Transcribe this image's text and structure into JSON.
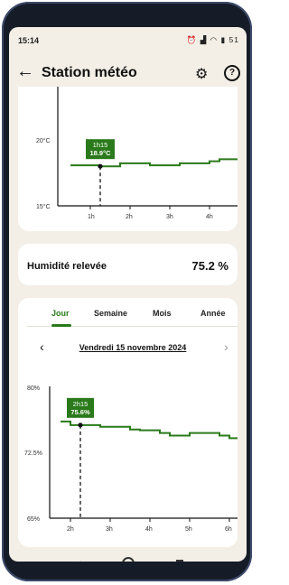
{
  "status": {
    "time": "15:14",
    "battery": "51"
  },
  "appbar": {
    "title": "Station météo"
  },
  "temp_chart": {
    "tooltip_time": "1h15",
    "tooltip_value": "18.9°C",
    "y_ticks": [
      "20°C",
      "15°C"
    ],
    "x_ticks": [
      "1h",
      "2h",
      "3h",
      "4h"
    ]
  },
  "humidity": {
    "label": "Humidité relevée",
    "value": "75.2 %"
  },
  "tabs": [
    "Jour",
    "Semaine",
    "Mois",
    "Année"
  ],
  "date_label": "Vendredi 15 novembre 2024",
  "humidity_chart": {
    "tooltip_time": "2h15",
    "tooltip_value": "75.6%",
    "y_ticks": [
      "80%",
      "72.5%",
      "65%"
    ],
    "x_ticks": [
      "2h",
      "3h",
      "4h",
      "5h",
      "6h"
    ]
  },
  "chart_data": [
    {
      "type": "line",
      "title": "",
      "ylabel": "",
      "xlabel": "",
      "ylim": [
        15,
        21.5
      ],
      "x": [
        "0h30",
        "0h45",
        "1h00",
        "1h15",
        "1h30",
        "1h45",
        "2h00",
        "2h15",
        "2h30",
        "2h45",
        "3h00",
        "3h15",
        "3h30",
        "3h45",
        "4h00",
        "4h15",
        "4h30",
        "4h45"
      ],
      "values": [
        19.0,
        19.0,
        19.0,
        18.9,
        18.9,
        19.2,
        19.2,
        19.2,
        19.0,
        19.0,
        19.0,
        19.2,
        19.2,
        19.2,
        19.4,
        19.6,
        19.6,
        19.4
      ],
      "highlight": {
        "x": "1h15",
        "y": 18.9
      }
    },
    {
      "type": "line",
      "title": "",
      "ylabel": "",
      "xlabel": "",
      "ylim": [
        65,
        80
      ],
      "x": [
        "1h45",
        "2h00",
        "2h15",
        "2h30",
        "2h45",
        "3h00",
        "3h15",
        "3h30",
        "3h45",
        "4h00",
        "4h15",
        "4h30",
        "4h45",
        "5h00",
        "5h15",
        "5h30",
        "5h45",
        "6h00",
        "6h15"
      ],
      "values": [
        76.0,
        75.6,
        75.6,
        75.6,
        75.4,
        75.4,
        75.4,
        75.1,
        75.0,
        75.0,
        74.7,
        74.4,
        74.4,
        74.7,
        74.7,
        74.7,
        74.4,
        74.1,
        74.1
      ],
      "highlight": {
        "x": "2h15",
        "y": 75.6
      }
    }
  ],
  "colors": {
    "accent": "#2a7a1b",
    "background": "#f3efe6"
  }
}
